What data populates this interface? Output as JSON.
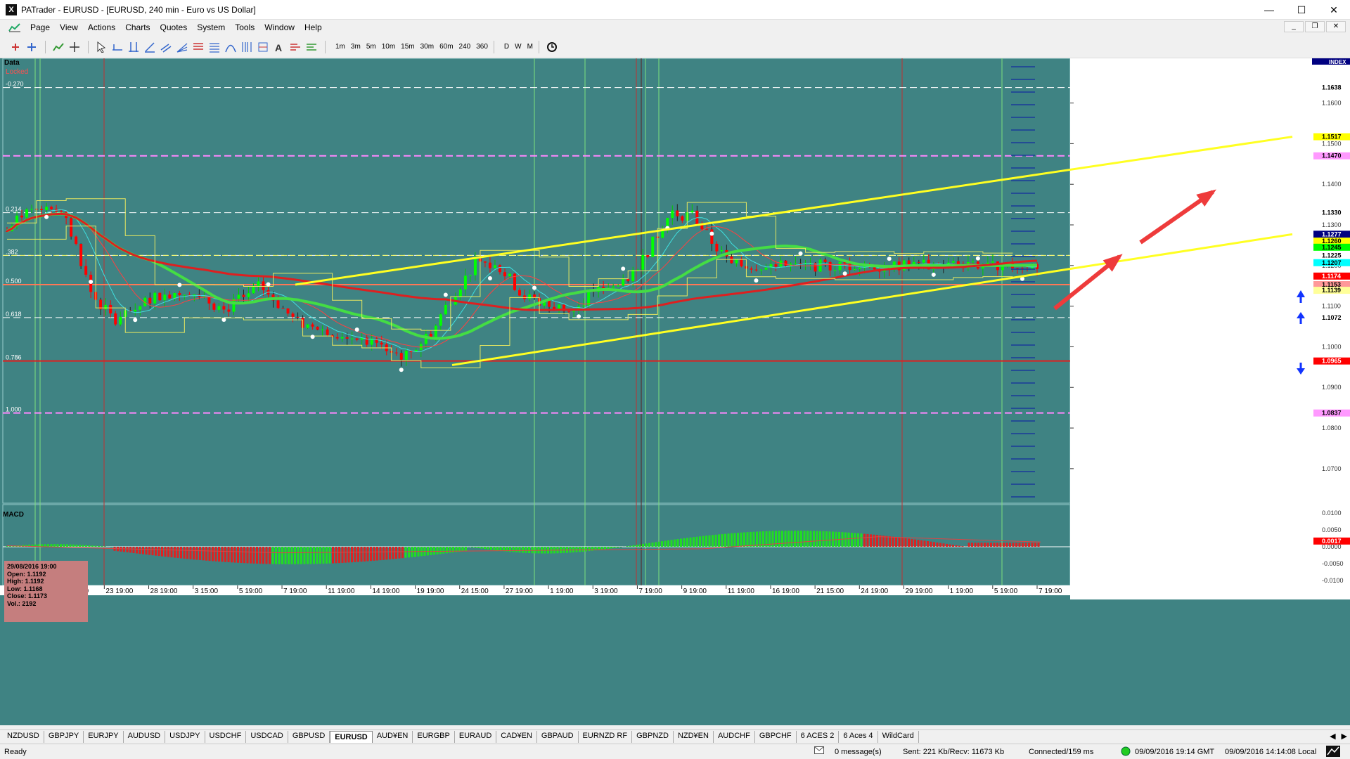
{
  "window": {
    "title": "PATrader - EURUSD - [EURUSD, 240 min - Euro vs US Dollar]",
    "app_icon": "X",
    "minimize": "—",
    "maximize": "☐",
    "close": "✕"
  },
  "menu": {
    "items": [
      "Page",
      "View",
      "Actions",
      "Charts",
      "Quotes",
      "System",
      "Tools",
      "Window",
      "Help"
    ],
    "mdi_buttons": [
      "_",
      "❐",
      "✕"
    ]
  },
  "toolbar": {
    "timeframes": [
      "1m",
      "3m",
      "5m",
      "10m",
      "15m",
      "30m",
      "60m",
      "240",
      "360"
    ],
    "periods": [
      "D",
      "W",
      "M"
    ]
  },
  "chart": {
    "data_label": "Data",
    "locked_label": "Locked",
    "index_label": "INDEX",
    "macd_label": "MACD",
    "fib_levels": [
      {
        "label": "-0.270",
        "price": 1.1638
      },
      {
        "label": "0.214",
        "price": 1.133
      },
      {
        "label": ".382",
        "price": 1.1225
      },
      {
        "label": "0.500",
        "price": 1.1153
      },
      {
        "label": "0.618",
        "price": 1.1072
      },
      {
        "label": "0.786",
        "price": 1.0965
      },
      {
        "label": "1.000",
        "price": 1.0837
      }
    ],
    "price_axis": {
      "ticks": [
        "1.1600",
        "1.1500",
        "1.1400",
        "1.1300",
        "1.1200",
        "1.1100",
        "1.1000",
        "1.0900",
        "1.0800",
        "1.0700"
      ],
      "tick_values": [
        1.16,
        1.15,
        1.14,
        1.13,
        1.12,
        1.11,
        1.1,
        1.09,
        1.08,
        1.07
      ],
      "markers": [
        {
          "text": "1.1638",
          "value": 1.1638,
          "bg": "#ffffff",
          "fg": "#000000"
        },
        {
          "text": "1.1517",
          "value": 1.1517,
          "bg": "#ffff00",
          "fg": "#000000"
        },
        {
          "text": "1.1470",
          "value": 1.147,
          "bg": "#ff99ff",
          "fg": "#000000"
        },
        {
          "text": "1.1330",
          "value": 1.133,
          "bg": "#ffffff",
          "fg": "#000000"
        },
        {
          "text": "1.1277",
          "value": 1.1277,
          "bg": "#000080",
          "fg": "#ffffff"
        },
        {
          "text": "1.1260",
          "value": 1.126,
          "bg": "#ffff00",
          "fg": "#000000"
        },
        {
          "text": "1.1245",
          "value": 1.1245,
          "bg": "#00ff00",
          "fg": "#000000"
        },
        {
          "text": "1.1225",
          "value": 1.1225,
          "bg": "#ffffff",
          "fg": "#000000"
        },
        {
          "text": "1.1207",
          "value": 1.1207,
          "bg": "#00ffff",
          "fg": "#000000"
        },
        {
          "text": "1.1174",
          "value": 1.1174,
          "bg": "#ff0000",
          "fg": "#ffffff"
        },
        {
          "text": "1.1153",
          "value": 1.1153,
          "bg": "#ff9999",
          "fg": "#000000"
        },
        {
          "text": "1.1139",
          "value": 1.1139,
          "bg": "#ffff99",
          "fg": "#000000"
        },
        {
          "text": "1.1072",
          "value": 1.1072,
          "bg": "#ffffff",
          "fg": "#000000"
        },
        {
          "text": "1.0965",
          "value": 1.0965,
          "bg": "#ff0000",
          "fg": "#ffffff"
        },
        {
          "text": "1.0837",
          "value": 1.0837,
          "bg": "#ff99ff",
          "fg": "#000000"
        }
      ]
    },
    "macd_axis": {
      "ticks": [
        "0.0100",
        "0.0050",
        "0.0000",
        "-0.0050",
        "-0.0100"
      ],
      "tick_values": [
        0.01,
        0.005,
        0.0,
        -0.005,
        -0.01
      ],
      "marker": {
        "text": "0.0017",
        "value": 0.0017
      }
    },
    "date_ticks": [
      "07:00",
      "20 19:00",
      "23 19:00",
      "28 19:00",
      "3 15:00",
      "5 19:00",
      "7 19:00",
      "11 19:00",
      "14 19:00",
      "19 19:00",
      "24 15:00",
      "27 19:00",
      "1 19:00",
      "3 19:00",
      "7 19:00",
      "9 19:00",
      "11 19:00",
      "16 19:00",
      "21 15:00",
      "24 19:00",
      "29 19:00",
      "1 19:00",
      "5 19:00",
      "7 19:00"
    ],
    "info_box": {
      "date": "29/08/2016 19:00",
      "open": "Open: 1.1192",
      "high": "High: 1.1192",
      "low": "Low: 1.1168",
      "close": "Close: 1.1173",
      "vol": "Vol.: 2192"
    },
    "colors": {
      "background": "#3f8383",
      "bull": "#00ff00",
      "bear": "#ff0000",
      "trend": "#ffff00",
      "arrow": "#ee3b3b"
    }
  },
  "tabs": {
    "items": [
      "NZDUSD",
      "GBPJPY",
      "EURJPY",
      "AUDUSD",
      "USDJPY",
      "USDCHF",
      "USDCAD",
      "GBPUSD",
      "EURUSD",
      "AUD¥EN",
      "EURGBP",
      "EURAUD",
      "CAD¥EN",
      "GBPAUD",
      "EURNZD RF",
      "GBPNZD",
      "NZD¥EN",
      "AUDCHF",
      "GBPCHF",
      "6 ACES 2",
      "6 Aces 4",
      "WildCard"
    ],
    "active": "EURUSD"
  },
  "status": {
    "ready": "Ready",
    "messages": "0 message(s)",
    "traffic": "Sent: 221 Kb/Recv: 11673 Kb",
    "connection": "Connected/159 ms",
    "gmt_time": "09/09/2016 19:14 GMT",
    "local_time": "09/09/2016 14:14:08 Local"
  }
}
